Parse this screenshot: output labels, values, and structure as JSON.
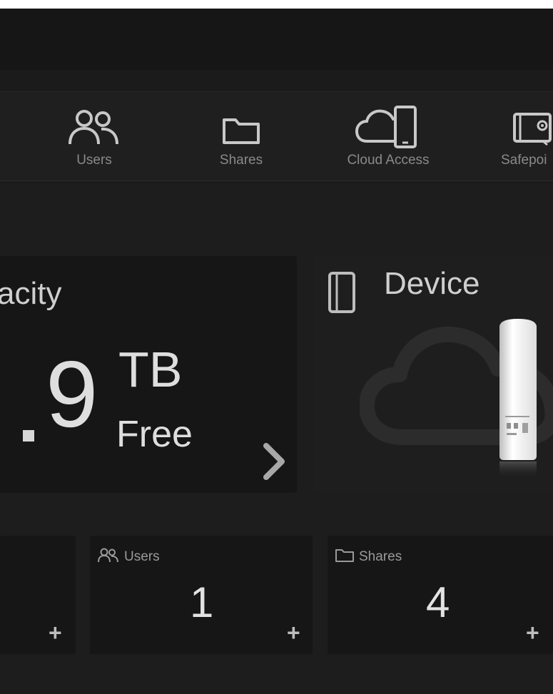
{
  "nav": {
    "items": [
      {
        "label": "Users",
        "icon": "users-icon"
      },
      {
        "label": "Shares",
        "icon": "folder-icon"
      },
      {
        "label": "Cloud Access",
        "icon": "cloud-device-icon"
      },
      {
        "label": "Safepoi",
        "icon": "safepoint-icon"
      }
    ]
  },
  "capacity": {
    "title": "acity",
    "value": "9",
    "unit": "TB",
    "status": "Free"
  },
  "device": {
    "title": "Device",
    "icon": "drive-icon"
  },
  "cards": {
    "users": {
      "label": "Users",
      "value": "1",
      "icon": "users-icon"
    },
    "shares": {
      "label": "Shares",
      "value": "4",
      "icon": "folder-icon"
    }
  },
  "colors": {
    "background": "#1c1c1c",
    "card": "#161616",
    "text": "#dedede",
    "muted": "#8a8a8a"
  }
}
